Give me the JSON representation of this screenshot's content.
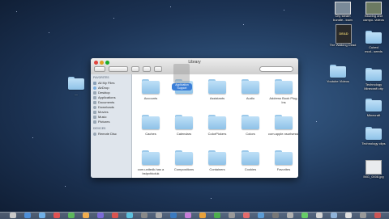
{
  "desktop": {
    "left_folder_label": "....",
    "right_icons": [
      {
        "name": "video-file-1",
        "label": "City steam bundle...town"
      },
      {
        "name": "video-file-2",
        "label": "Blowing and campo..videos"
      },
      {
        "name": "walking-dead-app",
        "label": "The Walking Dead"
      },
      {
        "name": "folder-cubed",
        "label": "Cubed mod...seeds"
      },
      {
        "name": "folder-youtube",
        "label": "Youtube Videos"
      },
      {
        "name": "folder-technology",
        "label": "Technology Minecraft city"
      },
      {
        "name": "folder-minecraft",
        "label": "Minecraft"
      },
      {
        "name": "folder-tech-clips",
        "label": "Technology clips"
      },
      {
        "name": "screenshot-file",
        "label": "IMG_0008.jpg"
      }
    ]
  },
  "window": {
    "title": "Library",
    "sidebar": {
      "favorites_header": "FAVORITES",
      "devices_header": "DEVICES",
      "favorites": [
        "All My Files",
        "AirDrop",
        "Desktop",
        "Applications",
        "Documents",
        "Downloads",
        "Movies",
        "Music",
        "Pictures"
      ],
      "devices": [
        "Remote Disc"
      ]
    },
    "folders": [
      {
        "label": "Accounts"
      },
      {
        "label": ""
      },
      {
        "label": "Assistants"
      },
      {
        "label": "Audio"
      },
      {
        "label": "Address Book Plug-Ins"
      },
      {
        "label": "Caches"
      },
      {
        "label": "Calendars"
      },
      {
        "label": "ColorPickers"
      },
      {
        "label": "Colors"
      },
      {
        "label": "com.apple.nsurlsessiond"
      },
      {
        "label": "com.unitedk.has a bstpxhkoluk"
      },
      {
        "label": "Compositions"
      },
      {
        "label": "Containers"
      },
      {
        "label": "Cookies"
      },
      {
        "label": "Favorites"
      },
      {
        "label": ""
      },
      {
        "label": ""
      },
      {
        "label": ""
      },
      {
        "label": ""
      },
      {
        "label": ""
      }
    ],
    "drag_badge": "Application Support"
  }
}
